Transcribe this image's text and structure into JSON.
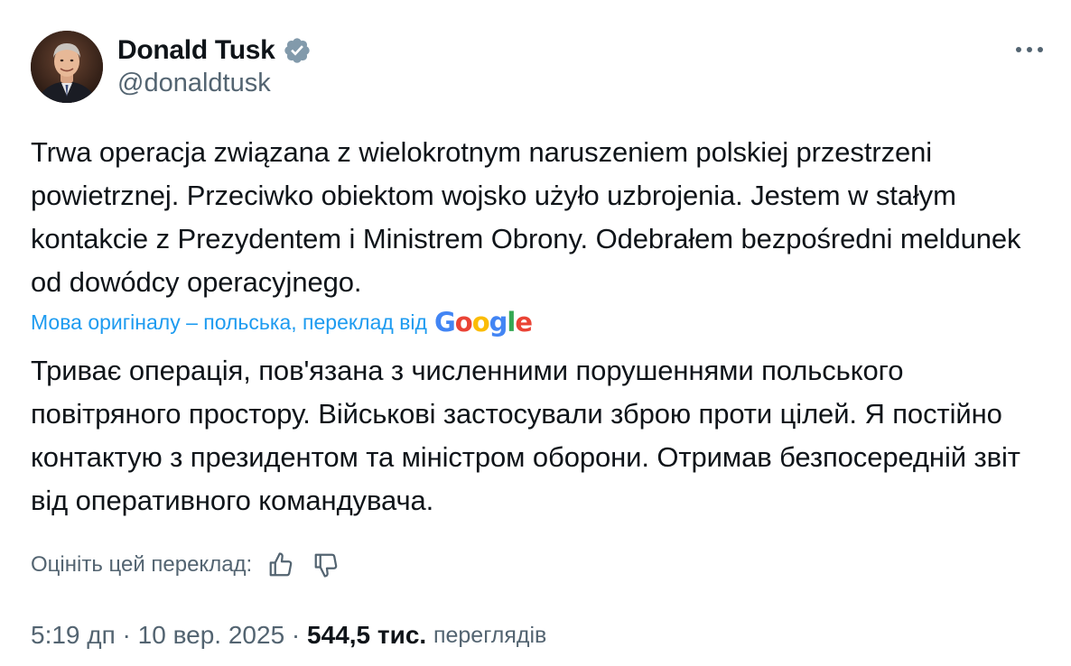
{
  "author": {
    "display_name": "Donald Tusk",
    "handle": "@donaldtusk",
    "avatar_icon": "avatar-photo",
    "verified_icon": "verified-badge-icon",
    "verified_color": "#829aab"
  },
  "menu": {
    "more_icon": "more-horizontal-icon"
  },
  "tweet": {
    "text": "Trwa operacja związana z wielokrotnym naruszeniem polskiej przestrzeni powietrznej. Przeciwko obiektom wojsko użyło uzbrojenia. Jestem w stałym kontakcie z Prezydentem i Ministrem Obrony. Odebrałem bezpośredni meldunek od dowódcy operacyjnego."
  },
  "translation": {
    "note": "Мова оригіналу – польська, переклад від",
    "provider": "Google",
    "provider_letters": [
      "G",
      "o",
      "o",
      "g",
      "l",
      "e"
    ],
    "provider_colors": [
      "#4285f4",
      "#ea4335",
      "#fbbc05",
      "#4285f4",
      "#34a853",
      "#ea4335"
    ],
    "text": "Триває операція, пов'язана з численними порушеннями польського повітряного простору. Військові застосували зброю проти цілей. Я постійно контактую з президентом та міністром оборони. Отримав безпосередній звіт від оперативного командувача."
  },
  "rating": {
    "label": "Оцініть цей переклад:",
    "thumbs_up_icon": "thumbs-up-icon",
    "thumbs_down_icon": "thumbs-down-icon"
  },
  "meta": {
    "time": "5:19 дп",
    "separator": " · ",
    "date": "10 вер. 2025",
    "views_count": "544,5 тис.",
    "views_label": "переглядів"
  },
  "colors": {
    "text_primary": "#0f1419",
    "text_secondary": "#536471",
    "link": "#1d9bf0"
  }
}
